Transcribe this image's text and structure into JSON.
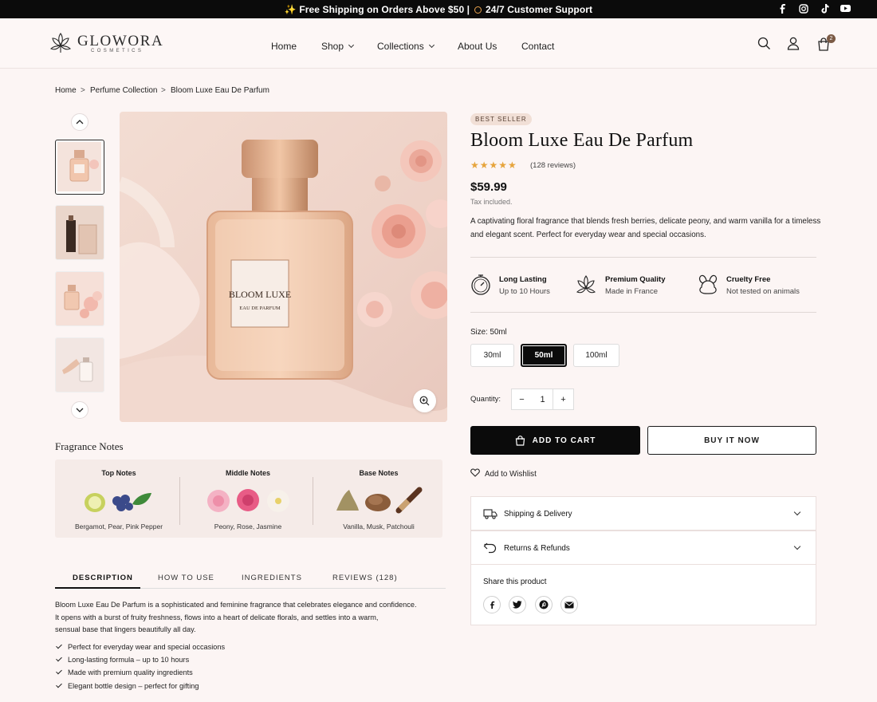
{
  "announcement": {
    "star": "✨",
    "shipping": "Free Shipping on Orders Above $50",
    "sep": "|",
    "support": "24/7 Customer Support",
    "social_icons": [
      "facebook-icon",
      "instagram-icon",
      "tiktok-icon",
      "youtube-icon"
    ]
  },
  "brand": {
    "name": "GLOWORA",
    "tagline": "COSMETICS"
  },
  "nav": {
    "items": [
      {
        "label": "Home"
      },
      {
        "label": "Shop"
      },
      {
        "label": "Collections"
      },
      {
        "label": "About Us"
      },
      {
        "label": "Contact"
      }
    ],
    "cart_count": "2"
  },
  "breadcrumb": [
    "Home",
    "Perfume Collection",
    "Bloom Luxe Eau De Parfum"
  ],
  "breadcrumb_sep": ">",
  "gallery": {
    "thumbnails": 4,
    "label_brand": "BLOOM LUXE",
    "label_sub": "EAU DE PARFUM"
  },
  "fragrance_notes": {
    "title": "Fragrance Notes",
    "columns": [
      {
        "title": "Top Notes",
        "list": "Bergamot, Pear, Pink Pepper"
      },
      {
        "title": "Middle Notes",
        "list": "Peony, Rose, Jasmine"
      },
      {
        "title": "Base Notes",
        "list": "Vanilla, Musk, Patchouli"
      }
    ]
  },
  "tabs": [
    "DESCRIPTION",
    "HOW TO USE",
    "INGREDIENTS",
    "REVIEWS (128)"
  ],
  "description": {
    "lines": [
      "Bloom Luxe Eau De Parfum is a sophisticated and feminine fragrance that celebrates elegance and confidence.",
      "It opens with a burst of fruity freshness, flows into a heart of delicate florals, and settles into a warm,",
      "sensual base that lingers beautifully all day."
    ],
    "bullets": [
      "Perfect for everyday wear and special occasions",
      "Long-lasting formula – up to 10 hours",
      "Made with premium quality ingredients",
      "Elegant bottle design – perfect for gifting"
    ]
  },
  "product": {
    "badge": "BEST SELLER",
    "title": "Bloom Luxe Eau De Parfum",
    "rating": 4.5,
    "rating_stars": "★★★★",
    "reviews": "(128 reviews)",
    "price": "$59.99",
    "tax_note": "Tax included.",
    "description": "A captivating floral fragrance that blends fresh berries, delicate peony, and warm vanilla for a timeless and elegant scent. Perfect for everyday wear and special occasions.",
    "features": [
      {
        "title": "Long Lasting",
        "sub": "Up to 10 Hours"
      },
      {
        "title": "Premium Quality",
        "sub": "Made in France"
      },
      {
        "title": "Cruelty Free",
        "sub": "Not tested on animals"
      }
    ],
    "size_label": "Size: 50ml",
    "sizes": [
      "30ml",
      "50ml",
      "100ml"
    ],
    "selected_size": "50ml",
    "quantity_label": "Quantity:",
    "quantity": "1",
    "minus": "−",
    "plus": "+",
    "add_to_cart": "ADD TO CART",
    "buy_now": "BUY IT NOW",
    "wishlist": "Add to Wishlist",
    "accordions": [
      "Shipping & Delivery",
      "Returns & Refunds"
    ],
    "share_title": "Share this product"
  },
  "colors": {
    "accent": "#0b0b0b",
    "badge_bg": "#f1dfd6",
    "star": "#e6a43c",
    "page_bg": "#fcf5f4"
  }
}
